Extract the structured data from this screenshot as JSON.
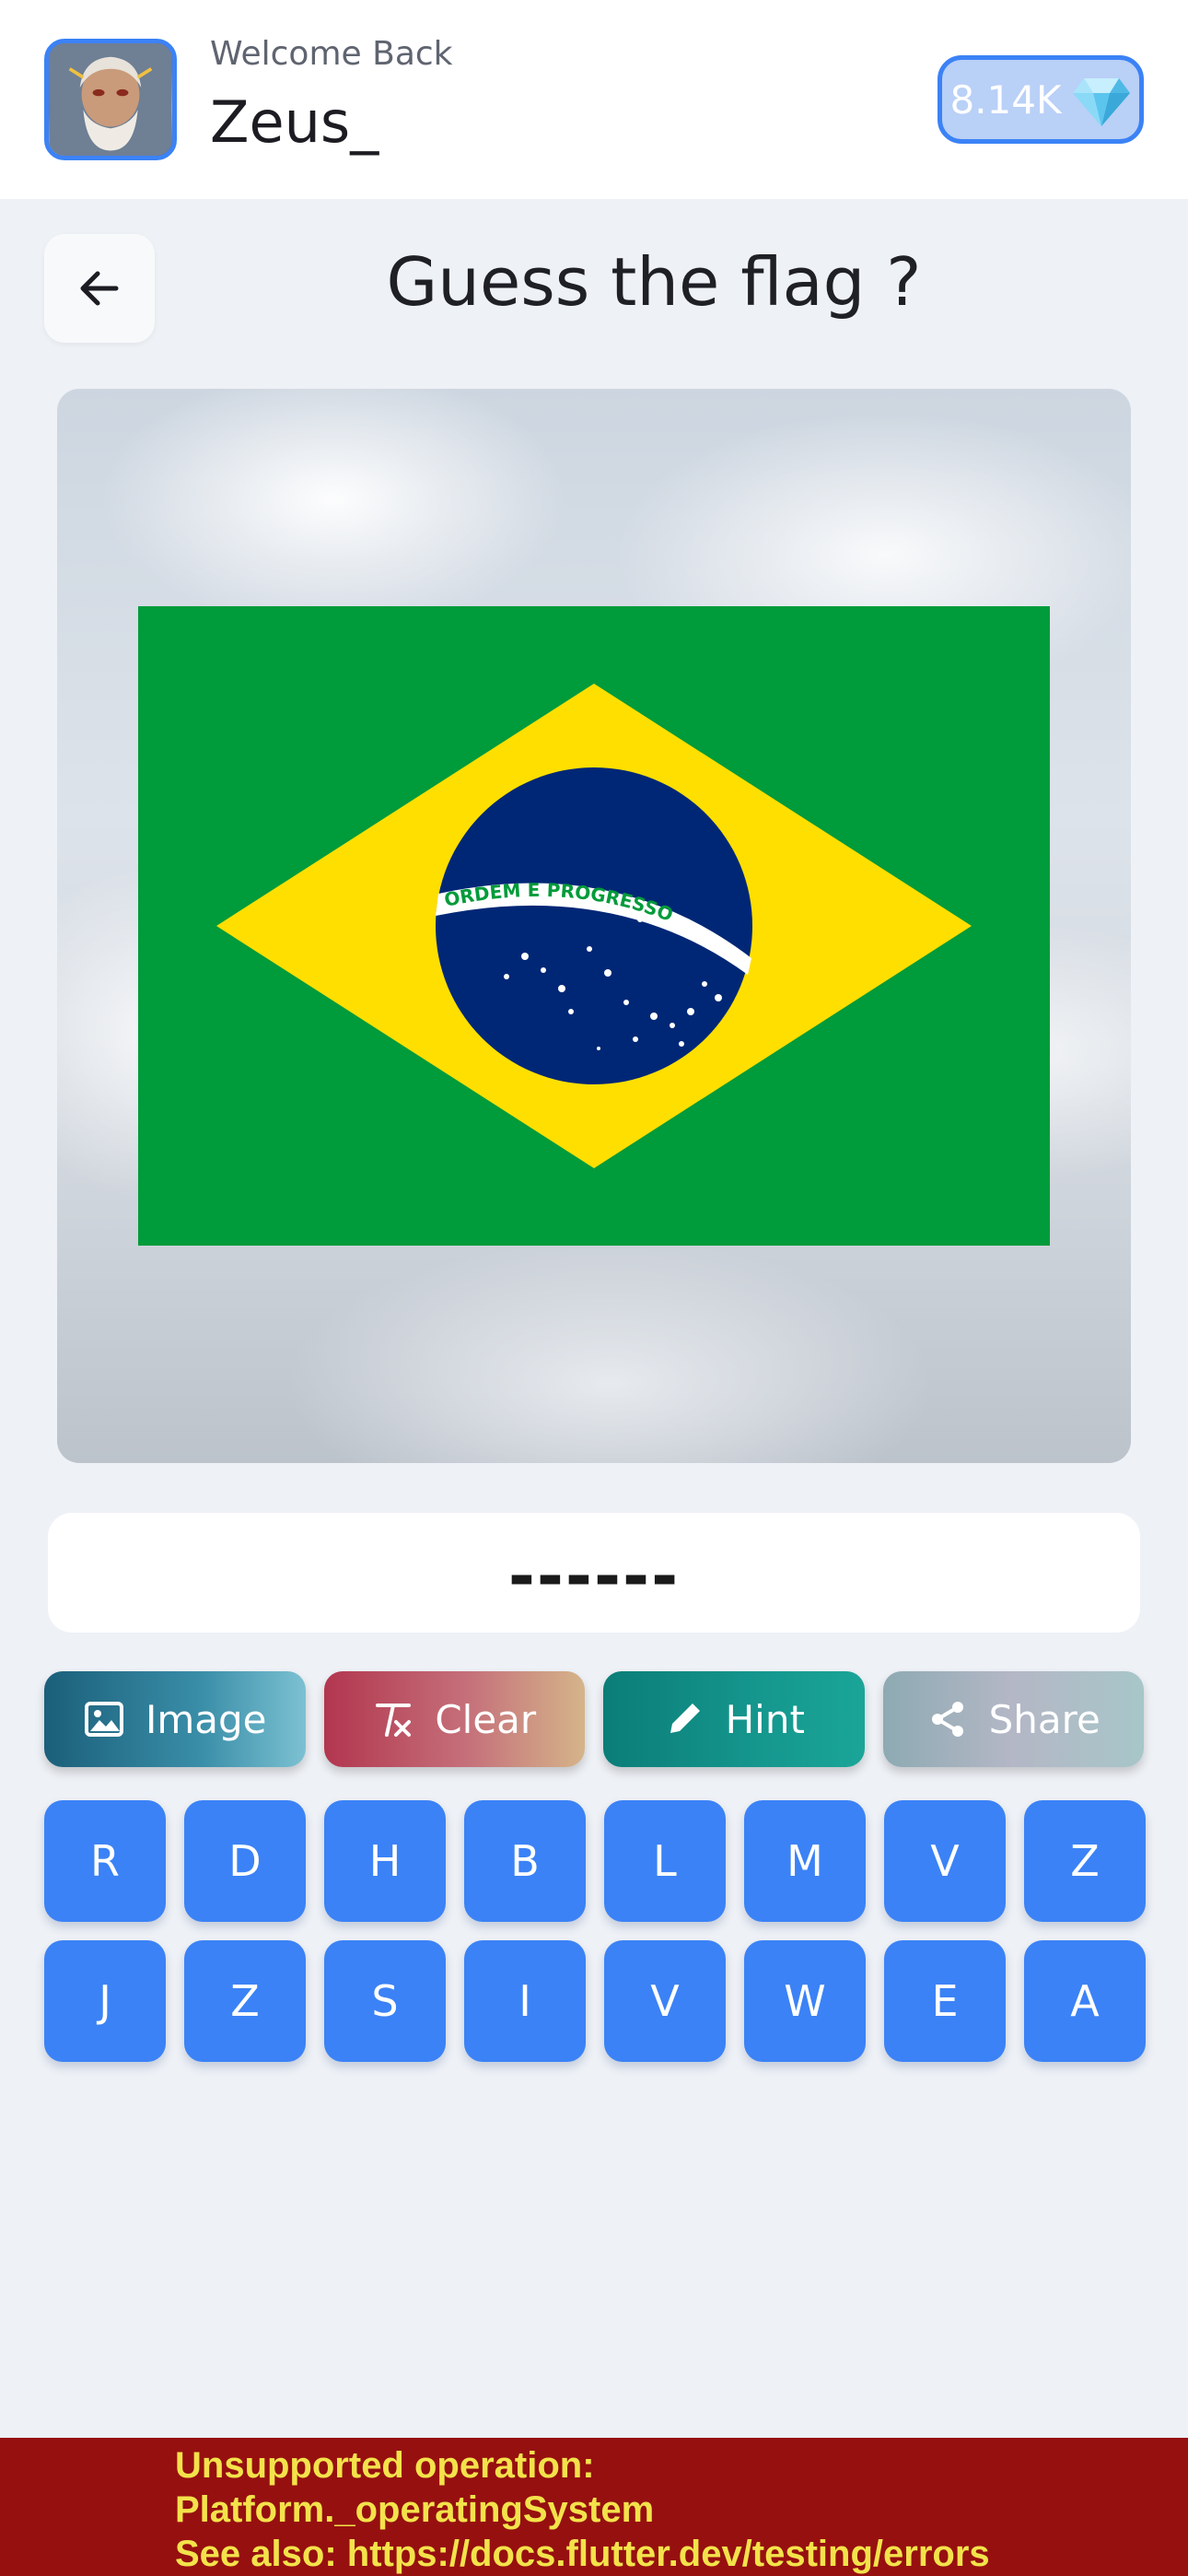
{
  "header": {
    "welcome": "Welcome Back",
    "username": "Zeus_",
    "gems": "8.14K",
    "gem_icon": "diamond-icon"
  },
  "page": {
    "title": "Guess the flag ?",
    "back_icon": "arrow-left-icon"
  },
  "flag": {
    "country_motto": "ORDEM E PROGRESSO",
    "colors": {
      "green": "#009b3a",
      "yellow": "#fedf00",
      "blue": "#002776"
    }
  },
  "answer": {
    "value": "------"
  },
  "actions": [
    {
      "label": "Image",
      "icon": "image-icon"
    },
    {
      "label": "Clear",
      "icon": "clear-format-icon"
    },
    {
      "label": "Hint",
      "icon": "pencil-icon"
    },
    {
      "label": "Share",
      "icon": "share-icon"
    }
  ],
  "keys": [
    "R",
    "D",
    "H",
    "B",
    "L",
    "M",
    "V",
    "Z",
    "J",
    "Z",
    "S",
    "I",
    "V",
    "W",
    "E",
    "A"
  ],
  "error": {
    "line1": "Unsupported operation:",
    "line2": "Platform._operatingSystem",
    "line3": "See also: https://docs.flutter.dev/testing/errors"
  },
  "colors": {
    "accent": "#3b82f6",
    "background": "#eef1f6",
    "error_bg": "#961010",
    "error_text": "#f3e24a"
  }
}
